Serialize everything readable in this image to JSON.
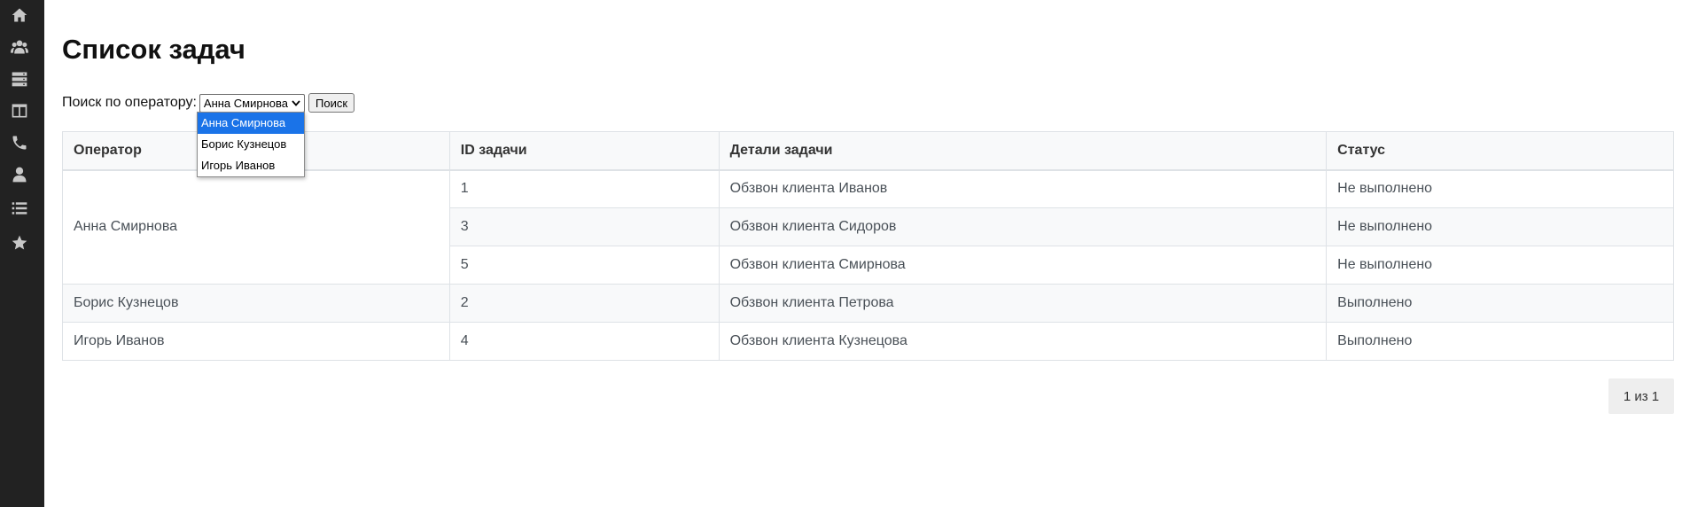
{
  "sidebar": {
    "icons": [
      "home-icon",
      "users-icon",
      "server-icon",
      "columns-icon",
      "phone-icon",
      "user-icon",
      "list-icon",
      "star-icon"
    ]
  },
  "page": {
    "title": "Список задач"
  },
  "search": {
    "label": "Поиск по оператору:",
    "selected": "Анна Смирнова",
    "options": [
      "Анна Смирнова",
      "Борис Кузнецов",
      "Игорь Иванов"
    ],
    "button": "Поиск"
  },
  "table": {
    "headers": [
      "Оператор",
      "ID задачи",
      "Детали задачи",
      "Статус"
    ],
    "groups": [
      {
        "operator": "Анна Смирнова",
        "tasks": [
          {
            "id": "1",
            "details": "Обзвон клиента Иванов",
            "status": "Не выполнено"
          },
          {
            "id": "3",
            "details": "Обзвон клиента Сидоров",
            "status": "Не выполнено"
          },
          {
            "id": "5",
            "details": "Обзвон клиента Смирнова",
            "status": "Не выполнено"
          }
        ]
      },
      {
        "operator": "Борис Кузнецов",
        "tasks": [
          {
            "id": "2",
            "details": "Обзвон клиента Петрова",
            "status": "Выполнено"
          }
        ]
      },
      {
        "operator": "Игорь Иванов",
        "tasks": [
          {
            "id": "4",
            "details": "Обзвон клиента Кузнецова",
            "status": "Выполнено"
          }
        ]
      }
    ]
  },
  "pagination": {
    "text": "1 из 1"
  }
}
